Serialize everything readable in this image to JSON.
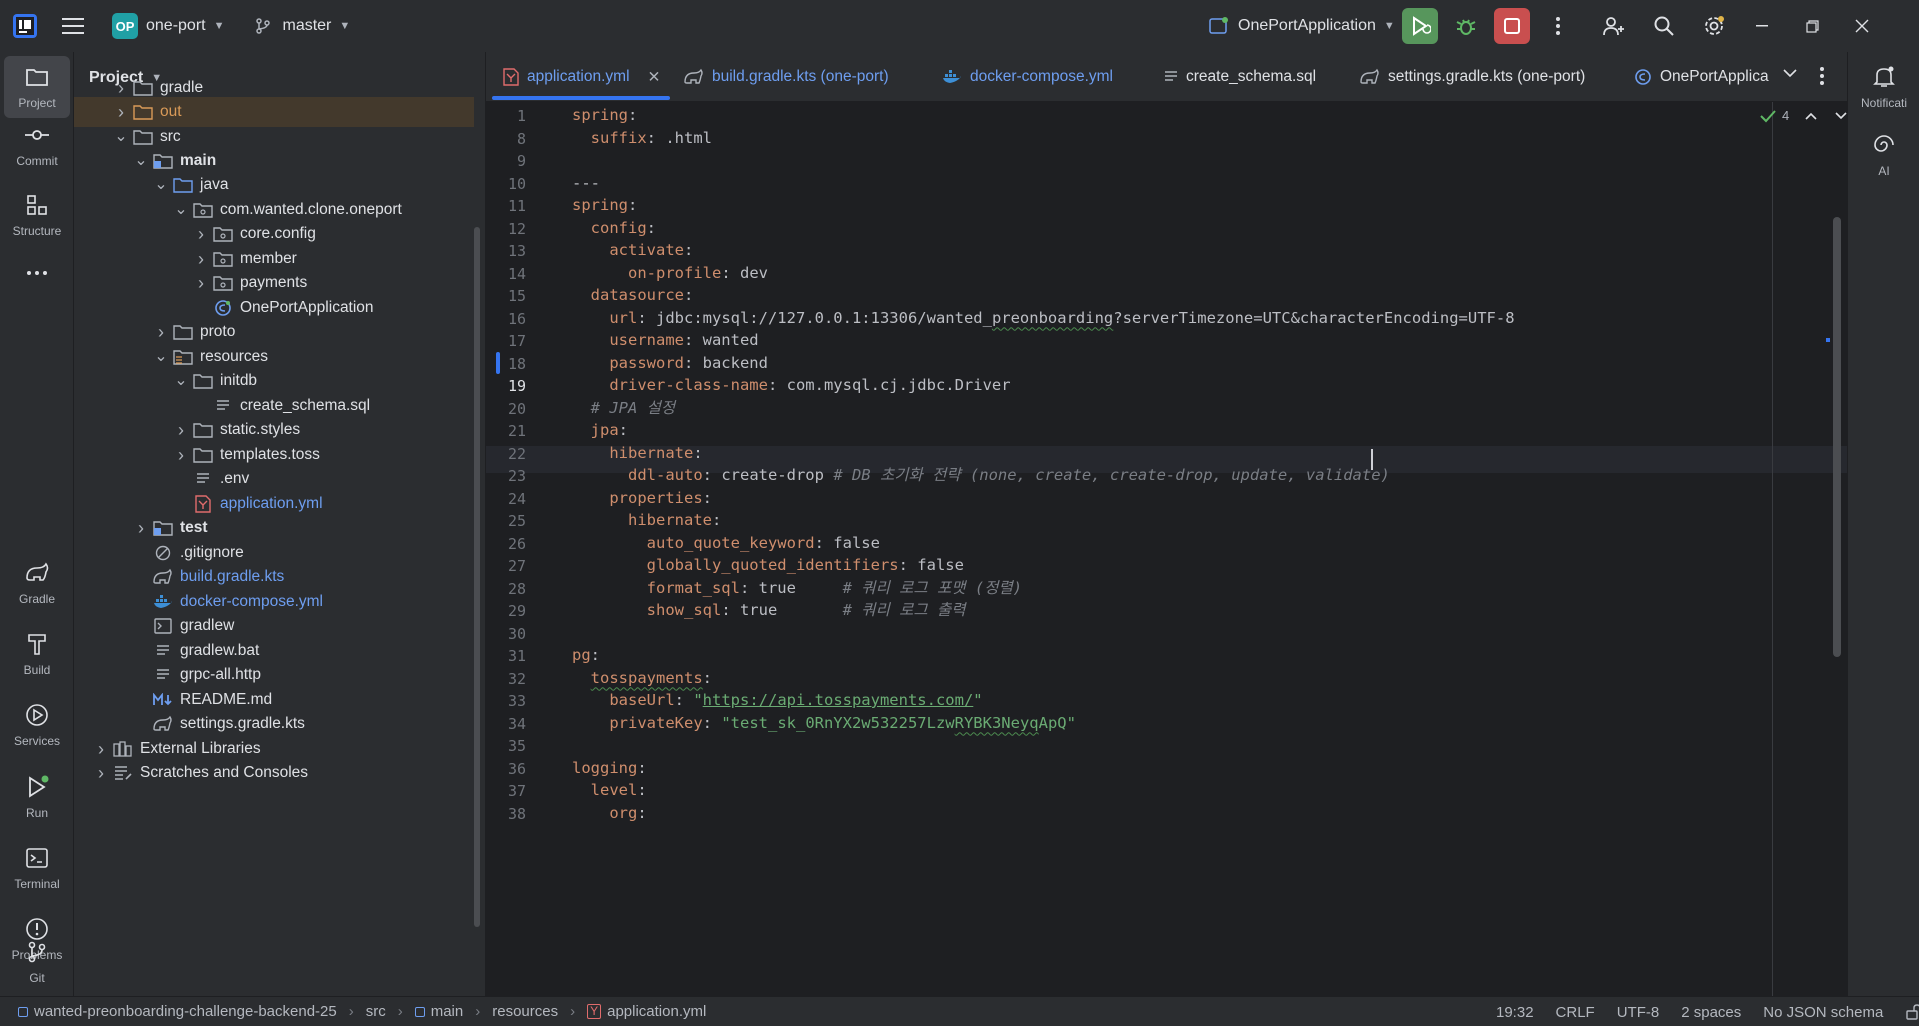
{
  "titlebar": {
    "project_badge": "OP",
    "project_name": "one-port",
    "branch": "master",
    "run_config": "OnePortApplication"
  },
  "left_strip": [
    {
      "label": "Project"
    },
    {
      "label": "Commit"
    },
    {
      "label": "Structure"
    },
    {
      "label": "Gradle"
    },
    {
      "label": "Build"
    },
    {
      "label": "Services"
    },
    {
      "label": "Run"
    },
    {
      "label": "Terminal"
    },
    {
      "label": "Problems"
    },
    {
      "label": "Git"
    }
  ],
  "right_strip": [
    {
      "label": "Notificati"
    },
    {
      "label": "AI"
    }
  ],
  "project_panel": {
    "title": "Project",
    "tree": [
      {
        "label": "gradle",
        "kind": "folder"
      },
      {
        "label": "out",
        "kind": "folder-orange"
      },
      {
        "label": "src",
        "kind": "folder"
      },
      {
        "label": "main",
        "kind": "folder-src"
      },
      {
        "label": "java",
        "kind": "folder-blue"
      },
      {
        "label": "com.wanted.clone.oneport",
        "kind": "package"
      },
      {
        "label": "core.config",
        "kind": "package"
      },
      {
        "label": "member",
        "kind": "package"
      },
      {
        "label": "payments",
        "kind": "package"
      },
      {
        "label": "OnePortApplication",
        "kind": "spring"
      },
      {
        "label": "proto",
        "kind": "folder"
      },
      {
        "label": "resources",
        "kind": "folder-res"
      },
      {
        "label": "initdb",
        "kind": "folder"
      },
      {
        "label": "create_schema.sql",
        "kind": "text"
      },
      {
        "label": "static.styles",
        "kind": "folder"
      },
      {
        "label": "templates.toss",
        "kind": "folder"
      },
      {
        "label": ".env",
        "kind": "text"
      },
      {
        "label": "application.yml",
        "kind": "yaml"
      },
      {
        "label": "test",
        "kind": "folder-src"
      },
      {
        "label": ".gitignore",
        "kind": "ignore"
      },
      {
        "label": "build.gradle.kts",
        "kind": "gradle"
      },
      {
        "label": "docker-compose.yml",
        "kind": "docker"
      },
      {
        "label": "gradlew",
        "kind": "terminal"
      },
      {
        "label": "gradlew.bat",
        "kind": "text"
      },
      {
        "label": "grpc-all.http",
        "kind": "text"
      },
      {
        "label": "README.md",
        "kind": "md"
      },
      {
        "label": "settings.gradle.kts",
        "kind": "gradle"
      },
      {
        "label": "External Libraries",
        "kind": "lib"
      },
      {
        "label": "Scratches and Consoles",
        "kind": "scratch"
      }
    ]
  },
  "tabs": [
    {
      "label": "application.yml",
      "active": true
    },
    {
      "label": "build.gradle.kts (one-port)"
    },
    {
      "label": "docker-compose.yml"
    },
    {
      "label": "create_schema.sql"
    },
    {
      "label": "settings.gradle.kts (one-port)"
    },
    {
      "label": "OnePortApplica"
    }
  ],
  "editor": {
    "inspection_count": "4",
    "lines": [
      {
        "n": "1",
        "parts": [
          [
            "k",
            "spring"
          ],
          [
            "v",
            ":"
          ]
        ]
      },
      {
        "n": "8",
        "parts": [
          [
            "v",
            "  "
          ],
          [
            "k",
            "suffix"
          ],
          [
            "v",
            ": .html"
          ]
        ]
      },
      {
        "n": "9",
        "parts": []
      },
      {
        "n": "10",
        "parts": [
          [
            "v",
            "---"
          ]
        ]
      },
      {
        "n": "11",
        "parts": [
          [
            "k",
            "spring"
          ],
          [
            "v",
            ":"
          ]
        ]
      },
      {
        "n": "12",
        "parts": [
          [
            "v",
            "  "
          ],
          [
            "k",
            "config"
          ],
          [
            "v",
            ":"
          ]
        ]
      },
      {
        "n": "13",
        "parts": [
          [
            "v",
            "    "
          ],
          [
            "k",
            "activate"
          ],
          [
            "v",
            ":"
          ]
        ]
      },
      {
        "n": "14",
        "parts": [
          [
            "v",
            "      "
          ],
          [
            "k",
            "on-profile"
          ],
          [
            "v",
            ": dev"
          ]
        ]
      },
      {
        "n": "15",
        "parts": [
          [
            "v",
            "  "
          ],
          [
            "k",
            "datasource"
          ],
          [
            "v",
            ":"
          ]
        ]
      },
      {
        "n": "16",
        "parts": [
          [
            "v",
            "    "
          ],
          [
            "k",
            "url"
          ],
          [
            "v",
            ": jdbc:mysql://127.0.0.1:13306/wanted_"
          ],
          [
            "q",
            "preonboarding"
          ],
          [
            "v",
            "?serverTimezone=UTC&characterEncoding=UTF-8"
          ]
        ]
      },
      {
        "n": "17",
        "parts": [
          [
            "v",
            "    "
          ],
          [
            "k",
            "username"
          ],
          [
            "v",
            ": wanted"
          ]
        ]
      },
      {
        "n": "18",
        "parts": [
          [
            "v",
            "    "
          ],
          [
            "k",
            "password"
          ],
          [
            "v",
            ": backend"
          ]
        ]
      },
      {
        "n": "19",
        "parts": [
          [
            "v",
            "    "
          ],
          [
            "k",
            "driver-class-name"
          ],
          [
            "v",
            ": com.mysql.cj.jdbc.Driver"
          ]
        ]
      },
      {
        "n": "20",
        "parts": [
          [
            "v",
            "  "
          ],
          [
            "c",
            "# JPA 설정"
          ]
        ]
      },
      {
        "n": "21",
        "parts": [
          [
            "v",
            "  "
          ],
          [
            "k",
            "jpa"
          ],
          [
            "v",
            ":"
          ]
        ]
      },
      {
        "n": "22",
        "parts": [
          [
            "v",
            "    "
          ],
          [
            "k",
            "hibernate"
          ],
          [
            "v",
            ":"
          ]
        ]
      },
      {
        "n": "23",
        "parts": [
          [
            "v",
            "      "
          ],
          [
            "k",
            "ddl-auto"
          ],
          [
            "v",
            ": create-drop "
          ],
          [
            "c",
            "# DB 초기화 전략 (none, create, create-drop, update, validate)"
          ]
        ]
      },
      {
        "n": "24",
        "parts": [
          [
            "v",
            "    "
          ],
          [
            "k",
            "properties"
          ],
          [
            "v",
            ":"
          ]
        ]
      },
      {
        "n": "25",
        "parts": [
          [
            "v",
            "      "
          ],
          [
            "k",
            "hibernate"
          ],
          [
            "v",
            ":"
          ]
        ]
      },
      {
        "n": "26",
        "parts": [
          [
            "v",
            "        "
          ],
          [
            "k",
            "auto_quote_keyword"
          ],
          [
            "v",
            ": false"
          ]
        ]
      },
      {
        "n": "27",
        "parts": [
          [
            "v",
            "        "
          ],
          [
            "k",
            "globally_quoted_identifiers"
          ],
          [
            "v",
            ": false"
          ]
        ]
      },
      {
        "n": "28",
        "parts": [
          [
            "v",
            "        "
          ],
          [
            "k",
            "format_sql"
          ],
          [
            "v",
            ": true     "
          ],
          [
            "c",
            "# 쿼리 로그 포맷 (정렬)"
          ]
        ]
      },
      {
        "n": "29",
        "parts": [
          [
            "v",
            "        "
          ],
          [
            "k",
            "show_sql"
          ],
          [
            "v",
            ": true       "
          ],
          [
            "c",
            "# 쿼리 로그 출력"
          ]
        ]
      },
      {
        "n": "30",
        "parts": []
      },
      {
        "n": "31",
        "parts": [
          [
            "k",
            "pg"
          ],
          [
            "v",
            ":"
          ]
        ]
      },
      {
        "n": "32",
        "parts": [
          [
            "v",
            "  "
          ],
          [
            "kq",
            "tosspayments"
          ],
          [
            "v",
            ":"
          ]
        ]
      },
      {
        "n": "33",
        "parts": [
          [
            "v",
            "    "
          ],
          [
            "k",
            "baseUrl"
          ],
          [
            "v",
            ": "
          ],
          [
            "s",
            "\""
          ],
          [
            "u",
            "https://api.tosspayments.com/"
          ],
          [
            "s",
            "\""
          ]
        ]
      },
      {
        "n": "34",
        "parts": [
          [
            "v",
            "    "
          ],
          [
            "k",
            "privateKey"
          ],
          [
            "v",
            ": "
          ],
          [
            "s",
            "\"test_sk_0RnYX2w532257Lzw"
          ],
          [
            "sq",
            "RYBK3Neyq"
          ],
          [
            "s",
            "ApQ\""
          ]
        ]
      },
      {
        "n": "35",
        "parts": []
      },
      {
        "n": "36",
        "parts": [
          [
            "k",
            "logging"
          ],
          [
            "v",
            ":"
          ]
        ]
      },
      {
        "n": "37",
        "parts": [
          [
            "v",
            "  "
          ],
          [
            "k",
            "level"
          ],
          [
            "v",
            ":"
          ]
        ]
      },
      {
        "n": "38",
        "parts": [
          [
            "v",
            "    "
          ],
          [
            "k",
            "org"
          ],
          [
            "v",
            ":"
          ]
        ]
      }
    ]
  },
  "statusbar": {
    "breadcrumbs": [
      "wanted-preonboarding-challenge-backend-25",
      "src",
      "main",
      "resources",
      "application.yml"
    ],
    "position": "19:32",
    "line_sep": "CRLF",
    "encoding": "UTF-8",
    "indent": "2 spaces",
    "schema": "No JSON schema"
  }
}
